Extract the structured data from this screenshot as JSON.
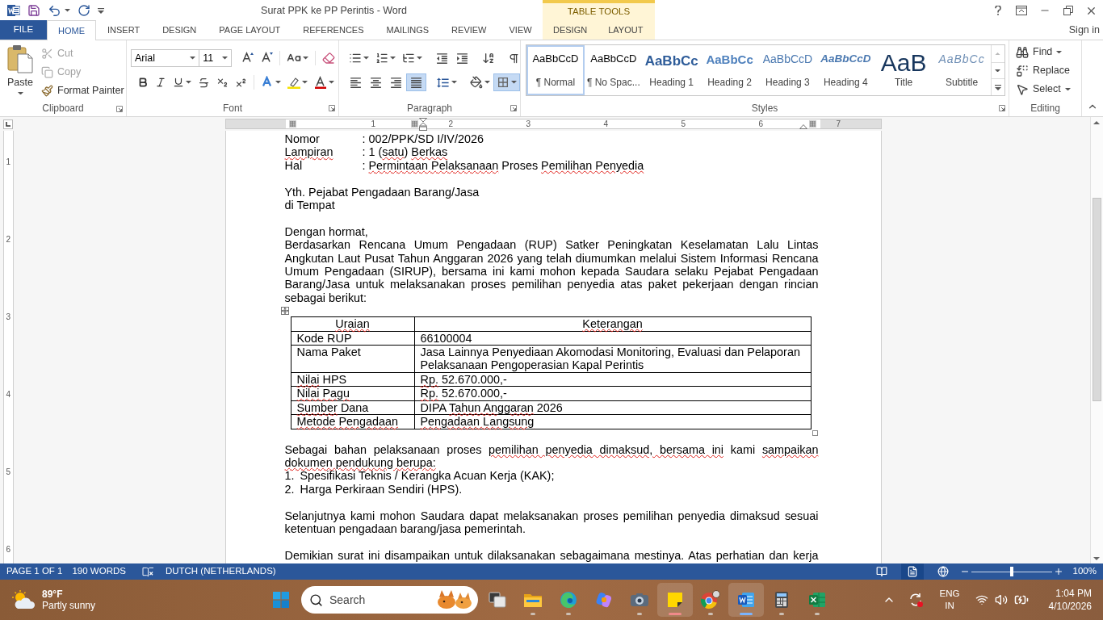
{
  "title_bar": {
    "title": "Surat PPK ke PP Perintis - Word",
    "contextual_group": "TABLE TOOLS"
  },
  "tabs": [
    {
      "label": "FILE",
      "kind": "file",
      "selected": false
    },
    {
      "label": "HOME",
      "kind": "standard",
      "selected": true
    },
    {
      "label": "INSERT",
      "kind": "standard",
      "selected": false
    },
    {
      "label": "DESIGN",
      "kind": "standard",
      "selected": false
    },
    {
      "label": "PAGE LAYOUT",
      "kind": "standard",
      "selected": false
    },
    {
      "label": "REFERENCES",
      "kind": "standard",
      "selected": false
    },
    {
      "label": "MAILINGS",
      "kind": "standard",
      "selected": false
    },
    {
      "label": "REVIEW",
      "kind": "standard",
      "selected": false
    },
    {
      "label": "VIEW",
      "kind": "standard",
      "selected": false
    },
    {
      "label": "DESIGN",
      "kind": "contextual",
      "selected": false
    },
    {
      "label": "LAYOUT",
      "kind": "contextual",
      "selected": false
    }
  ],
  "account": {
    "label": "Sign in"
  },
  "clipboard": {
    "label": "Clipboard",
    "paste": "Paste",
    "commands": [
      {
        "label": "Cut",
        "kind": "cut",
        "disabled": true
      },
      {
        "label": "Copy",
        "kind": "copy",
        "disabled": true
      },
      {
        "label": "Format Painter",
        "kind": "format_painter",
        "disabled": false
      }
    ]
  },
  "font": {
    "label": "Font",
    "font_name": "Arial",
    "font_size": "11"
  },
  "paragraph": {
    "label": "Paragraph",
    "alignments": [
      {
        "kind": "left",
        "selected": false
      },
      {
        "kind": "center",
        "selected": false
      },
      {
        "kind": "right",
        "selected": false
      },
      {
        "kind": "justify",
        "selected": true
      }
    ],
    "borders": {
      "selected": true
    }
  },
  "styles": {
    "label": "Styles",
    "items": [
      {
        "preview": "AaBbCcD",
        "label": "¶ Normal",
        "kind": "normal",
        "selected": true
      },
      {
        "preview": "AaBbCcD",
        "label": "¶ No Spac...",
        "kind": "no_spacing",
        "selected": false
      },
      {
        "preview": "AaBbCc",
        "label": "Heading 1",
        "kind": "heading1",
        "selected": false
      },
      {
        "preview": "AaBbCc",
        "label": "Heading 2",
        "kind": "heading2",
        "selected": false
      },
      {
        "preview": "AaBbCcD",
        "label": "Heading 3",
        "kind": "heading3",
        "selected": false
      },
      {
        "preview": "AaBbCcD",
        "label": "Heading 4",
        "kind": "heading4",
        "selected": false
      },
      {
        "preview": "AaB",
        "label": "Title",
        "kind": "title",
        "selected": false
      },
      {
        "preview": "AaBbCc",
        "label": "Subtitle",
        "kind": "subtitle",
        "selected": false
      }
    ]
  },
  "editing": {
    "label": "Editing",
    "commands": [
      {
        "label": "Find",
        "kind": "find"
      },
      {
        "label": "Replace",
        "kind": "replace"
      },
      {
        "label": "Select",
        "kind": "select"
      }
    ]
  },
  "ruler": {
    "marks": [
      "1",
      "2",
      "3",
      "4",
      "5",
      "6",
      "7"
    ]
  },
  "vertical_ruler": {
    "marks": [
      "1",
      "2",
      "3",
      "4",
      "5",
      "6"
    ]
  },
  "document": {
    "header_fields": [
      {
        "label": [
          {
            "text": "Nomor",
            "misspelled": false
          }
        ],
        "value": [
          {
            "text": ": 002/PPK/SD I/IV/2026",
            "misspelled": false
          }
        ]
      },
      {
        "label": [
          {
            "text": "Lampiran",
            "misspelled": true
          }
        ],
        "value": [
          {
            "text": ": 1 (",
            "misspelled": false
          },
          {
            "text": "satu",
            "misspelled": true
          },
          {
            "text": ") ",
            "misspelled": false
          },
          {
            "text": "Berkas",
            "misspelled": true
          }
        ]
      },
      {
        "label": [
          {
            "text": "Hal",
            "misspelled": false
          }
        ],
        "value": [
          {
            "text": ": ",
            "misspelled": false
          },
          {
            "text": "Permintaan Pelaksanaan",
            "misspelled": true
          },
          {
            "text": " Proses ",
            "misspelled": false
          },
          {
            "text": "Pemilihan Penyedia",
            "misspelled": true
          }
        ]
      }
    ],
    "recipient": [
      "Yth. Pejabat Pengadaan Barang/Jasa",
      "di Tempat"
    ],
    "salutation": "Dengan hormat,",
    "intro": "Berdasarkan Rencana Umum Pengadaan (RUP) Satker Peningkatan Keselamatan Lalu Lintas Angkutan Laut Pusat Tahun Anggaran 2026 yang telah diumumkan melalui Sistem Informasi Rencana Umum Pengadaan (SIRUP), bersama ini kami mohon kepada Saudara selaku Pejabat Pengadaan Barang/Jasa untuk melaksanakan proses pemilihan penyedia atas paket pekerjaan dengan rincian sebagai berikut:",
    "table": {
      "columns": [
        [
          {
            "text": "Uraian",
            "misspelled": true
          }
        ],
        [
          {
            "text": "Keterangan",
            "misspelled": true
          }
        ]
      ],
      "rows": [
        {
          "label": [
            {
              "text": "Kode RUP",
              "misspelled": false
            }
          ],
          "value": [
            {
              "text": "66100004",
              "misspelled": false
            }
          ]
        },
        {
          "label": [
            {
              "text": "Nama Paket",
              "misspelled": false
            }
          ],
          "value": [
            {
              "text": "Jasa Lainnya Penyediaan Akomodasi Monitoring, Evaluasi dan Pelaporan Pelaksanaan Pengoperasian Kapal Perintis",
              "misspelled": false
            }
          ]
        },
        {
          "label": [
            {
              "text": "Nilai",
              "misspelled": true
            },
            {
              "text": " HPS",
              "misspelled": false
            }
          ],
          "value": [
            {
              "text": "Rp.",
              "misspelled": true
            },
            {
              "text": " 52.670.000,-",
              "misspelled": false
            }
          ]
        },
        {
          "label": [
            {
              "text": "Nilai Pagu",
              "misspelled": true
            }
          ],
          "value": [
            {
              "text": "Rp.",
              "misspelled": true
            },
            {
              "text": " 52.670.000,-",
              "misspelled": false
            }
          ]
        },
        {
          "label": [
            {
              "text": "Sumber",
              "misspelled": true
            },
            {
              "text": " Dana",
              "misspelled": false
            }
          ],
          "value": [
            {
              "text": "DIPA ",
              "misspelled": false
            },
            {
              "text": "Tahun Anggaran",
              "misspelled": true
            },
            {
              "text": " 2026",
              "misspelled": false
            }
          ]
        },
        {
          "label": [
            {
              "text": "Metode Pengadaan",
              "misspelled": true
            }
          ],
          "value": [
            {
              "text": "Pengadaan Langsung",
              "misspelled": true
            }
          ]
        }
      ]
    },
    "supporting_intro": [
      {
        "text": "Sebagai bahan pelaksanaan proses ",
        "misspelled": false
      },
      {
        "text": "pemilihan penyedia dimaksud, bersama ini",
        "misspelled": true
      },
      {
        "text": " kami ",
        "misspelled": false
      },
      {
        "text": "sampaikan dokumen pendukung berupa:",
        "misspelled": true
      }
    ],
    "list": [
      {
        "marker": "1.",
        "text": "Spesifikasi Teknis / Kerangka Acuan Kerja (KAK);"
      },
      {
        "marker": "2.",
        "text": "Harga Perkiraan Sendiri (HPS)."
      }
    ],
    "request": "Selanjutnya kami mohon Saudara dapat melaksanakan proses pemilihan penyedia dimaksud sesuai ketentuan pengadaan barang/jasa pemerintah.",
    "closing": "Demikian surat ini disampaikan untuk dilaksanakan sebagaimana mestinya. Atas perhatian dan kerja"
  },
  "status_bar": {
    "page": "PAGE 1 OF 1",
    "words": "190 WORDS",
    "language": "DUTCH (NETHERLANDS)",
    "views": [
      {
        "kind": "read_mode",
        "selected": false
      },
      {
        "kind": "print_layout",
        "selected": true
      },
      {
        "kind": "web_layout",
        "selected": false
      }
    ],
    "zoom": {
      "level": 0.5,
      "reading": "100%"
    }
  },
  "taskbar": {
    "weather": {
      "temperature": "89°F",
      "condition": "Partly sunny"
    },
    "search": {
      "placeholder": "Search"
    },
    "apps": [
      {
        "kind": "task_view",
        "running": false,
        "active": false
      },
      {
        "kind": "file_explorer",
        "running": true,
        "active": false,
        "color": "#cdbfb3"
      },
      {
        "kind": "edge",
        "running": true,
        "active": false,
        "color": "#cdbfb3"
      },
      {
        "kind": "copilot",
        "running": false,
        "active": false
      },
      {
        "kind": "camera",
        "running": true,
        "active": false,
        "color": "#cdbfb3"
      },
      {
        "kind": "sticky_notes",
        "running": true,
        "active": true,
        "color": "#f08a8a"
      },
      {
        "kind": "chrome",
        "running": true,
        "active": false,
        "color": "#cdbfb3"
      },
      {
        "kind": "word",
        "running": true,
        "active": true,
        "color": "#7ab4ff"
      },
      {
        "kind": "calculator",
        "running": true,
        "active": false,
        "color": "#cdbfb3"
      },
      {
        "kind": "excel",
        "running": true,
        "active": false,
        "color": "#cdbfb3"
      }
    ],
    "input_language": "ENG",
    "input_region": "IN",
    "time": "1:04 PM",
    "date": "4/10/2026"
  }
}
